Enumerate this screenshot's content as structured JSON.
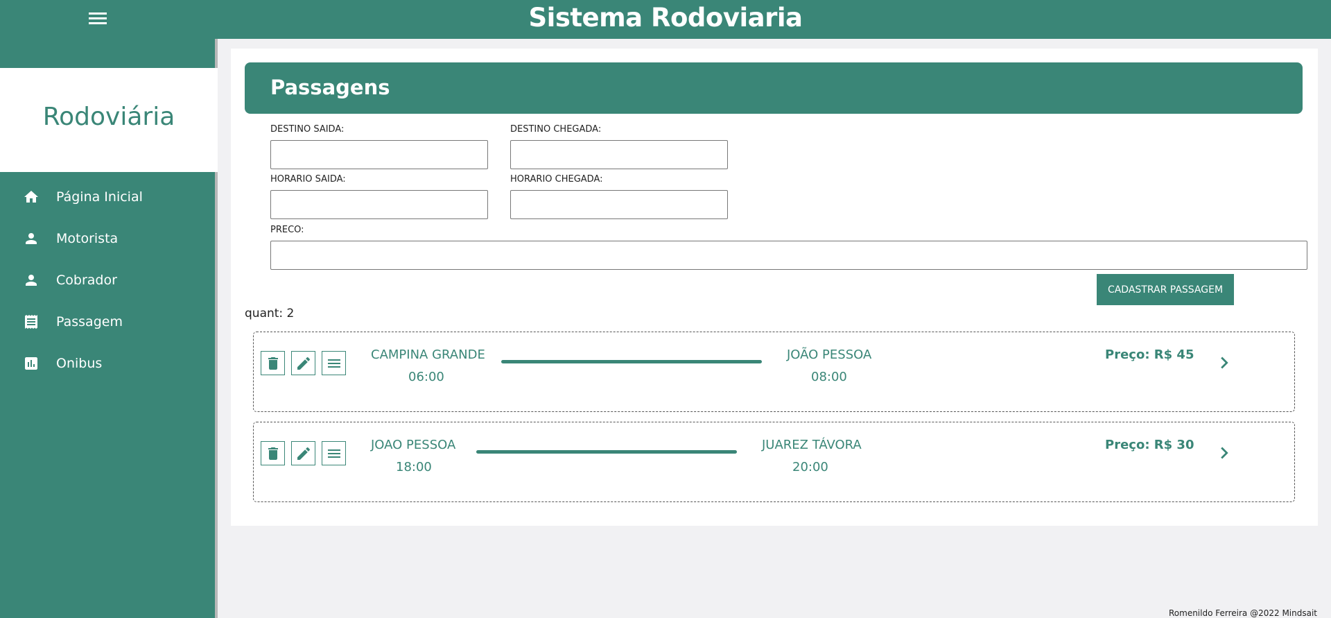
{
  "header": {
    "title": "Sistema Rodoviaria",
    "menu_icon": "hamburger-menu-icon"
  },
  "sidebar": {
    "brand": "Rodoviária",
    "items": [
      {
        "label": "Página Inicial",
        "icon": "home-icon"
      },
      {
        "label": "Motorista",
        "icon": "person-icon"
      },
      {
        "label": "Cobrador",
        "icon": "person-icon"
      },
      {
        "label": "Passagem",
        "icon": "receipt-icon"
      },
      {
        "label": "Onibus",
        "icon": "chart-icon"
      }
    ]
  },
  "main": {
    "title": "Passagens",
    "form": {
      "destino_saida_label": "DESTINO SAIDA:",
      "destino_saida_value": "",
      "destino_chegada_label": "DESTINO CHEGADA:",
      "destino_chegada_value": "",
      "horario_saida_label": "HORARIO SAIDA:",
      "horario_saida_value": "",
      "horario_chegada_label": "HORARIO CHEGADA:",
      "horario_chegada_value": "",
      "preco_label": "PRECO:",
      "preco_value": "",
      "submit_label": "CADASTRAR PASSAGEM"
    },
    "count_label": "quant: 2",
    "tickets": [
      {
        "origin": "CAMPINA GRANDE",
        "departure": "06:00",
        "destination": "JOÃO PESSOA",
        "arrival": "08:00",
        "price": "Preço: R$ 45"
      },
      {
        "origin": "JOAO PESSOA",
        "departure": "18:00",
        "destination": "JUAREZ TÁVORA",
        "arrival": "20:00",
        "price": "Preço: R$ 30"
      }
    ]
  },
  "footer": {
    "text": "Romenildo Ferreira @2022 Mindsait"
  },
  "colors": {
    "primary": "#3a8677",
    "background": "#f1f1f3"
  }
}
